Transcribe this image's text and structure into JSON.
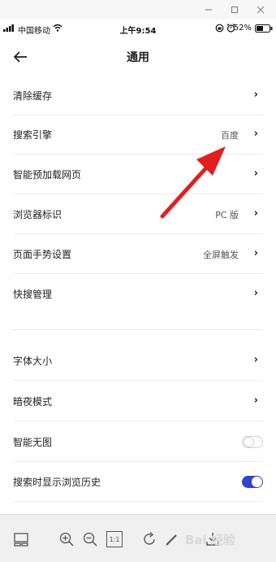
{
  "statusbar": {
    "carrier": "中国移动",
    "time": "上午9:54",
    "battery": "52%"
  },
  "header": {
    "title": "通用"
  },
  "settings": [
    {
      "label": "清除缓存",
      "value": ""
    },
    {
      "label": "搜索引擎",
      "value": "百度"
    },
    {
      "label": "智能预加载网页",
      "value": ""
    },
    {
      "label": "浏览器标识",
      "value": "PC 版"
    },
    {
      "label": "页面手势设置",
      "value": "全屏触发"
    },
    {
      "label": "快搜管理",
      "value": ""
    },
    {
      "label": "字体大小",
      "value": ""
    },
    {
      "label": "暗夜模式",
      "value": ""
    },
    {
      "label": "智能无图",
      "toggle": "off"
    },
    {
      "label": "搜索时显示浏览历史",
      "toggle": "on"
    }
  ],
  "colors": {
    "toggle_on": "#3344cc",
    "annotation_arrow": "#e21f1f"
  },
  "toolbar": {
    "icons": [
      "layout-icon",
      "zoom-in-icon",
      "zoom-out-icon",
      "actual-size-icon",
      "rotate-icon",
      "edit-icon",
      "download-icon"
    ],
    "actual_size_label": "1:1"
  },
  "watermark": "Bai 经验"
}
